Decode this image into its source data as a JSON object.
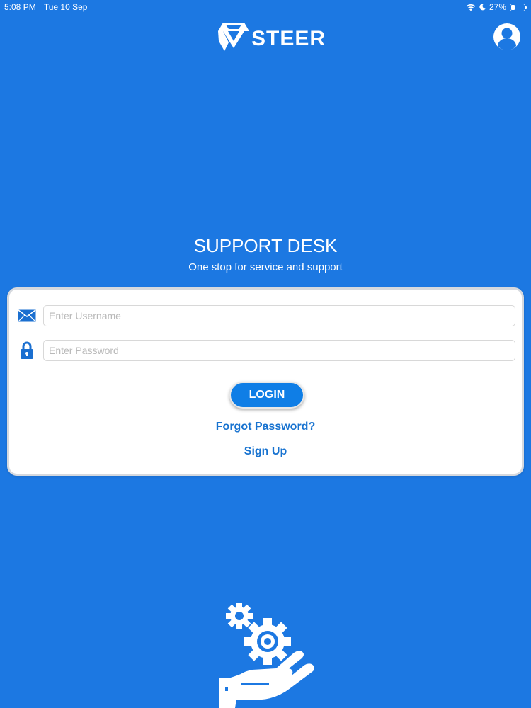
{
  "status_bar": {
    "time": "5:08 PM",
    "date": "Tue 10 Sep",
    "battery": "27%"
  },
  "header": {
    "brand": "STEER",
    "icons": {
      "logo": "steer-logo-icon",
      "profile": "user-profile-icon"
    }
  },
  "hero": {
    "title": "SUPPORT DESK",
    "subtitle": "One stop for service and support"
  },
  "login_form": {
    "username": {
      "value": "",
      "placeholder": "Enter Username",
      "icon": "envelope-icon"
    },
    "password": {
      "value": "",
      "placeholder": "Enter Password",
      "icon": "lock-icon"
    },
    "login_label": "LOGIN",
    "forgot_label": "Forgot Password?",
    "signup_label": "Sign Up"
  },
  "footer": {
    "icon": "gears-on-hand-icon"
  },
  "colors": {
    "background": "#1c78e2",
    "button": "#0f7ee6",
    "link": "#1873d0",
    "card": "#ffffff"
  }
}
